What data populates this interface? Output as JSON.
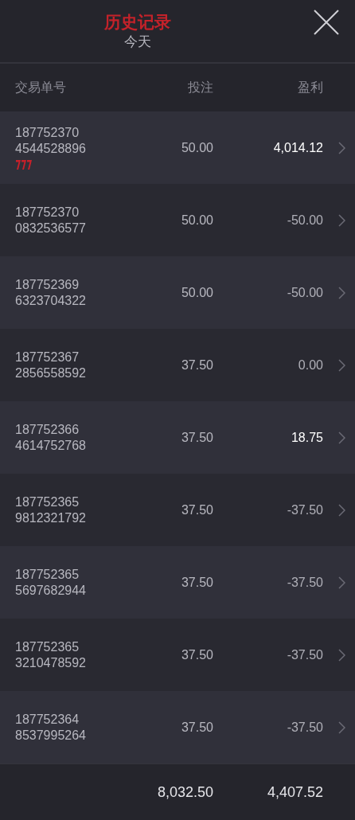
{
  "header": {
    "title": "历史记录",
    "subtitle": "今天"
  },
  "table": {
    "columns": [
      "交易单号",
      "投注",
      "盈利"
    ],
    "rows": [
      {
        "order_line1": "187752370",
        "order_line2": "4544528896",
        "stake": "50.00",
        "profit": "4,014.12",
        "won": true,
        "jackpot": true
      },
      {
        "order_line1": "187752370",
        "order_line2": "0832536577",
        "stake": "50.00",
        "profit": "-50.00",
        "won": false,
        "jackpot": false
      },
      {
        "order_line1": "187752369",
        "order_line2": "6323704322",
        "stake": "50.00",
        "profit": "-50.00",
        "won": false,
        "jackpot": false
      },
      {
        "order_line1": "187752367",
        "order_line2": "2856558592",
        "stake": "37.50",
        "profit": "0.00",
        "won": false,
        "jackpot": false
      },
      {
        "order_line1": "187752366",
        "order_line2": "4614752768",
        "stake": "37.50",
        "profit": "18.75",
        "won": true,
        "jackpot": false
      },
      {
        "order_line1": "187752365",
        "order_line2": "9812321792",
        "stake": "37.50",
        "profit": "-37.50",
        "won": false,
        "jackpot": false
      },
      {
        "order_line1": "187752365",
        "order_line2": "5697682944",
        "stake": "37.50",
        "profit": "-37.50",
        "won": false,
        "jackpot": false
      },
      {
        "order_line1": "187752365",
        "order_line2": "3210478592",
        "stake": "37.50",
        "profit": "-37.50",
        "won": false,
        "jackpot": false
      },
      {
        "order_line1": "187752364",
        "order_line2": "8537995264",
        "stake": "37.50",
        "profit": "-37.50",
        "won": false,
        "jackpot": false
      }
    ],
    "totals": {
      "stake": "8,032.50",
      "profit": "4,407.52"
    }
  }
}
